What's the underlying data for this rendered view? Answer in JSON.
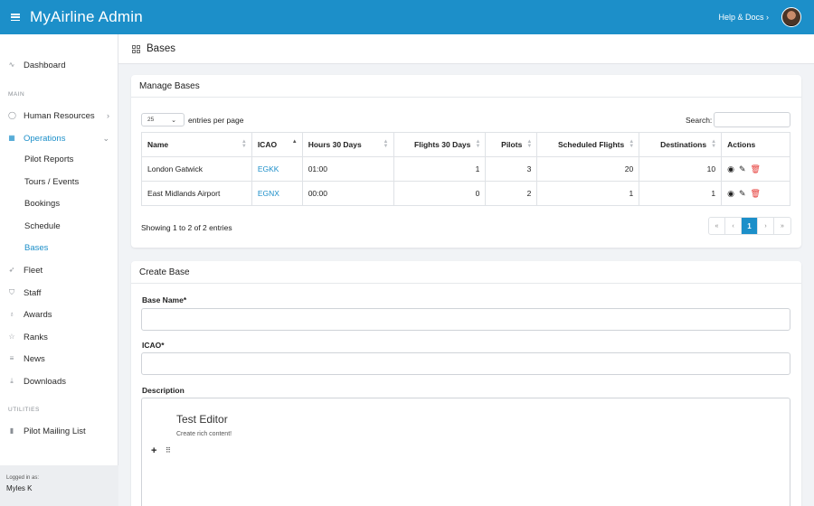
{
  "header": {
    "title": "MyAirline Admin",
    "help_label": "Help & Docs"
  },
  "sidebar": {
    "dashboard": "Dashboard",
    "sections": {
      "main": "MAIN",
      "utilities": "UTILITIES"
    },
    "items": {
      "human_resources": "Human Resources",
      "operations": "Operations",
      "fleet": "Fleet",
      "staff": "Staff",
      "awards": "Awards",
      "ranks": "Ranks",
      "news": "News",
      "downloads": "Downloads",
      "pilot_mailing_list": "Pilot Mailing List"
    },
    "operations_sub": [
      "Pilot Reports",
      "Tours / Events",
      "Bookings",
      "Schedule",
      "Bases"
    ],
    "logged_in_label": "Logged in as:",
    "logged_in_user": "Myles K"
  },
  "page": {
    "title": "Bases"
  },
  "manage_bases": {
    "title": "Manage Bases",
    "per_page_value": "25",
    "per_page_label": "entries per page",
    "search_label": "Search:",
    "search_value": "",
    "columns": [
      "Name",
      "ICAO",
      "Hours 30 Days",
      "Flights 30 Days",
      "Pilots",
      "Scheduled Flights",
      "Destinations",
      "Actions"
    ],
    "rows": [
      {
        "name": "London Gatwick",
        "icao": "EGKK",
        "hours": "01:00",
        "flights": "1",
        "pilots": "3",
        "scheduled": "20",
        "destinations": "10"
      },
      {
        "name": "East Midlands Airport",
        "icao": "EGNX",
        "hours": "00:00",
        "flights": "0",
        "pilots": "2",
        "scheduled": "1",
        "destinations": "1"
      }
    ],
    "showing": "Showing 1 to 2 of 2 entries",
    "pagination": {
      "first": "«",
      "prev": "‹",
      "current": "1",
      "next": "›",
      "last": "»"
    }
  },
  "create_base": {
    "title": "Create Base",
    "base_name_label": "Base Name*",
    "base_name_value": "",
    "icao_label": "ICAO*",
    "icao_value": "",
    "description_label": "Description",
    "editor_title": "Test Editor",
    "editor_subtitle": "Create rich content!",
    "editor_add": "+",
    "editor_drag": "⠿"
  },
  "colors": {
    "primary": "#1c8fc9",
    "danger": "#e53935",
    "background": "#f1f3f6"
  }
}
